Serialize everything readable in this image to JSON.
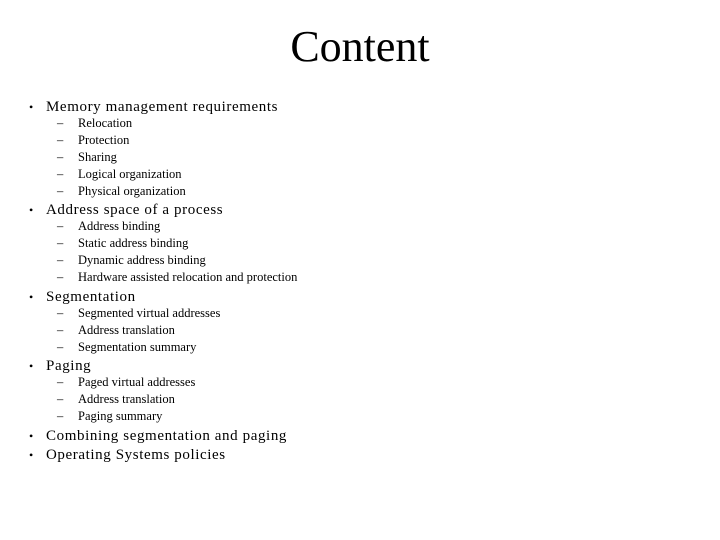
{
  "slide": {
    "title": "Content",
    "bullet_glyph": "•",
    "dash_glyph": "–",
    "items": [
      {
        "label": "Memory management requirements",
        "subitems": [
          "Relocation",
          "Protection",
          "Sharing",
          "Logical organization",
          "Physical organization"
        ]
      },
      {
        "label": "Address space of a process",
        "subitems": [
          "Address binding",
          "Static address binding",
          "Dynamic address binding",
          "Hardware assisted relocation and protection"
        ]
      },
      {
        "label": "Segmentation",
        "subitems": [
          "Segmented virtual addresses",
          "Address translation",
          "Segmentation summary"
        ]
      },
      {
        "label": "Paging",
        "subitems": [
          "Paged virtual addresses",
          "Address translation",
          "Paging summary"
        ]
      },
      {
        "label": "Combining segmentation and paging",
        "subitems": []
      },
      {
        "label": "Operating Systems policies",
        "subitems": []
      }
    ]
  }
}
